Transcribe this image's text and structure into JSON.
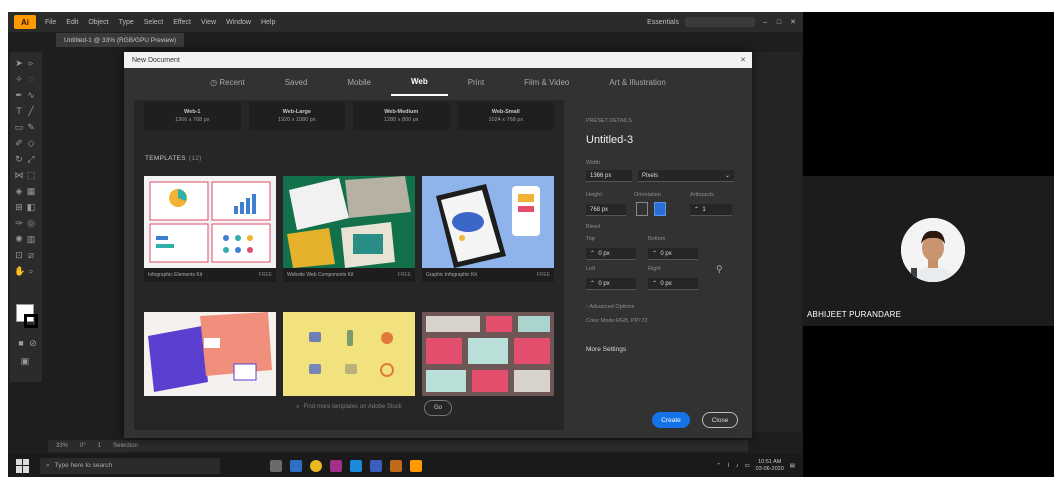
{
  "app": {
    "logo": "Ai",
    "menu": [
      "File",
      "Edit",
      "Object",
      "Type",
      "Select",
      "Effect",
      "View",
      "Window",
      "Help"
    ],
    "workspace": "Essentials",
    "doc_tab": "Untitled-1 @ 33% (RGB/GPU Preview)",
    "status": [
      "33%",
      "0°",
      "1",
      "Selection"
    ]
  },
  "dialog": {
    "title": "New Document",
    "close": "✕",
    "tabs": [
      "Recent",
      "Saved",
      "Mobile",
      "Web",
      "Print",
      "Film & Video",
      "Art & Illustration"
    ],
    "active_tab": "Web",
    "presets": [
      {
        "name": "Web-1",
        "size": "1366 x 768 px"
      },
      {
        "name": "Web-Large",
        "size": "1920 x 1080 px"
      },
      {
        "name": "Web-Medium",
        "size": "1280 x 800 px"
      },
      {
        "name": "Web-Small",
        "size": "1024 x 768 px"
      }
    ],
    "templates_heading": "TEMPLATES",
    "templates_count": "(12)",
    "templates": [
      {
        "name": "Infographic Elements Kit",
        "tag": "FREE"
      },
      {
        "name": "Website Web Components Kit",
        "tag": "FREE"
      },
      {
        "name": "Graphic Infographic Kit",
        "tag": "FREE"
      },
      {
        "name": "",
        "tag": ""
      },
      {
        "name": "",
        "tag": ""
      },
      {
        "name": "",
        "tag": ""
      }
    ],
    "search_placeholder": "Find more templates on Adobe Stock",
    "go_label": "Go",
    "details": {
      "section": "PRESET DETAILS",
      "doc_name": "Untitled-3",
      "width_label": "Width",
      "width_value": "1366 px",
      "width_unit": "Pixels",
      "height_label": "Height",
      "height_value": "768 px",
      "orientation_label": "Orientation",
      "artboards_label": "Artboards",
      "artboards_value": "1",
      "bleed_label": "Bleed",
      "top_label": "Top",
      "top_value": "0 px",
      "bottom_label": "Bottom",
      "bottom_value": "0 px",
      "left_label": "Left",
      "left_value": "0 px",
      "right_label": "Right",
      "right_value": "0 px",
      "advanced_options": "Advanced Options",
      "color_mode": "Color Mode:RGB, PPI:72",
      "more_settings": "More Settings"
    },
    "create_label": "Create",
    "close_label": "Close"
  },
  "taskbar": {
    "search_placeholder": "Type here to search",
    "time": "10:51 AM",
    "date": "03-06-2020"
  },
  "participant": {
    "name": "ABHIJEET PURANDARE"
  }
}
